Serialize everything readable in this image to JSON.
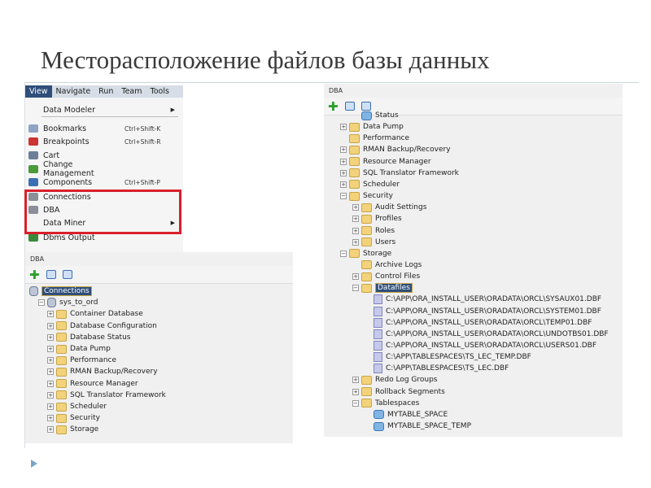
{
  "slide": {
    "title": "Месторасположение файлов базы данных"
  },
  "menu": {
    "bar": [
      "View",
      "Navigate",
      "Run",
      "Team",
      "Tools"
    ],
    "items": [
      {
        "label": "Data Modeler",
        "shortcut": "",
        "submenu": true,
        "icon": "none"
      },
      {
        "label": "Bookmarks",
        "shortcut": "Ctrl+Shift-K",
        "submenu": false,
        "icon": "bookmarks-icon"
      },
      {
        "label": "Breakpoints",
        "shortcut": "Ctrl+Shift-R",
        "submenu": false,
        "icon": "breakpoints-icon"
      },
      {
        "label": "Cart",
        "shortcut": "",
        "submenu": false,
        "icon": "cart-icon"
      },
      {
        "label": "Change Management",
        "shortcut": "",
        "submenu": false,
        "icon": "change-management-icon"
      },
      {
        "label": "Components",
        "shortcut": "Ctrl+Shift-P",
        "submenu": false,
        "icon": "components-icon"
      },
      {
        "label": "Connections",
        "shortcut": "",
        "submenu": false,
        "icon": "connections-icon"
      },
      {
        "label": "DBA",
        "shortcut": "",
        "submenu": false,
        "icon": "dba-icon"
      },
      {
        "label": "Data Miner",
        "shortcut": "",
        "submenu": true,
        "icon": "none"
      },
      {
        "label": "Dbms Output",
        "shortcut": "",
        "submenu": false,
        "icon": "dbms-output-icon"
      }
    ]
  },
  "left_panel": {
    "header": "DBA",
    "tree": [
      {
        "label": "Connections",
        "depth": 0,
        "kind": "root",
        "selected": true
      },
      {
        "label": "sys_to_ord",
        "depth": 1,
        "kind": "db",
        "exp": "-"
      },
      {
        "label": "Container Database",
        "depth": 2,
        "kind": "folder",
        "exp": "+"
      },
      {
        "label": "Database Configuration",
        "depth": 2,
        "kind": "folder",
        "exp": "+"
      },
      {
        "label": "Database Status",
        "depth": 2,
        "kind": "folder",
        "exp": "+"
      },
      {
        "label": "Data Pump",
        "depth": 2,
        "kind": "folder",
        "exp": "+"
      },
      {
        "label": "Performance",
        "depth": 2,
        "kind": "folder",
        "exp": "+"
      },
      {
        "label": "RMAN Backup/Recovery",
        "depth": 2,
        "kind": "folder",
        "exp": "+"
      },
      {
        "label": "Resource Manager",
        "depth": 2,
        "kind": "folder",
        "exp": "+"
      },
      {
        "label": "SQL Translator Framework",
        "depth": 2,
        "kind": "folder",
        "exp": "+"
      },
      {
        "label": "Scheduler",
        "depth": 2,
        "kind": "folder",
        "exp": "+"
      },
      {
        "label": "Security",
        "depth": 2,
        "kind": "folder",
        "exp": "+"
      },
      {
        "label": "Storage",
        "depth": 2,
        "kind": "folder",
        "exp": "+"
      }
    ]
  },
  "right_panel": {
    "header": "DBA",
    "tree": [
      {
        "label": "Status",
        "depth": 1,
        "kind": "status",
        "exp": ""
      },
      {
        "label": "Data Pump",
        "depth": 0,
        "kind": "folder",
        "exp": "+"
      },
      {
        "label": "Performance",
        "depth": 0,
        "kind": "folder",
        "exp": ""
      },
      {
        "label": "RMAN Backup/Recovery",
        "depth": 0,
        "kind": "folder",
        "exp": "+"
      },
      {
        "label": "Resource Manager",
        "depth": 0,
        "kind": "folder",
        "exp": "+"
      },
      {
        "label": "SQL Translator Framework",
        "depth": 0,
        "kind": "folder",
        "exp": "+"
      },
      {
        "label": "Scheduler",
        "depth": 0,
        "kind": "folder",
        "exp": "+"
      },
      {
        "label": "Security",
        "depth": 0,
        "kind": "folder",
        "exp": "-"
      },
      {
        "label": "Audit Settings",
        "depth": 1,
        "kind": "folder",
        "exp": "+"
      },
      {
        "label": "Profiles",
        "depth": 1,
        "kind": "folder",
        "exp": "+"
      },
      {
        "label": "Roles",
        "depth": 1,
        "kind": "folder",
        "exp": "+"
      },
      {
        "label": "Users",
        "depth": 1,
        "kind": "folder",
        "exp": "+"
      },
      {
        "label": "Storage",
        "depth": 0,
        "kind": "folder",
        "exp": "-"
      },
      {
        "label": "Archive Logs",
        "depth": 1,
        "kind": "folder",
        "exp": ""
      },
      {
        "label": "Control Files",
        "depth": 1,
        "kind": "folder",
        "exp": "+"
      },
      {
        "label": "Datafiles",
        "depth": 1,
        "kind": "folder",
        "exp": "-",
        "selected": true
      },
      {
        "label": "C:\\APP\\ORA_INSTALL_USER\\ORADATA\\ORCL\\SYSAUX01.DBF",
        "depth": 2,
        "kind": "file",
        "exp": ""
      },
      {
        "label": "C:\\APP\\ORA_INSTALL_USER\\ORADATA\\ORCL\\SYSTEM01.DBF",
        "depth": 2,
        "kind": "file",
        "exp": ""
      },
      {
        "label": "C:\\APP\\ORA_INSTALL_USER\\ORADATA\\ORCL\\TEMP01.DBF",
        "depth": 2,
        "kind": "file",
        "exp": ""
      },
      {
        "label": "C:\\APP\\ORA_INSTALL_USER\\ORADATA\\ORCL\\UNDOTBS01.DBF",
        "depth": 2,
        "kind": "file",
        "exp": ""
      },
      {
        "label": "C:\\APP\\ORA_INSTALL_USER\\ORADATA\\ORCL\\USERS01.DBF",
        "depth": 2,
        "kind": "file",
        "exp": ""
      },
      {
        "label": "C:\\APP\\TABLESPACES\\TS_LEC_TEMP.DBF",
        "depth": 2,
        "kind": "file",
        "exp": ""
      },
      {
        "label": "C:\\APP\\TABLESPACES\\TS_LEC.DBF",
        "depth": 2,
        "kind": "file",
        "exp": ""
      },
      {
        "label": "Redo Log Groups",
        "depth": 1,
        "kind": "folder",
        "exp": "+"
      },
      {
        "label": "Rollback Segments",
        "depth": 1,
        "kind": "folder",
        "exp": "+"
      },
      {
        "label": "Tablespaces",
        "depth": 1,
        "kind": "folder",
        "exp": "-"
      },
      {
        "label": "MYTABLE_SPACE",
        "depth": 2,
        "kind": "ts",
        "exp": ""
      },
      {
        "label": "MYTABLE_SPACE_TEMP",
        "depth": 2,
        "kind": "ts",
        "exp": ""
      }
    ]
  }
}
